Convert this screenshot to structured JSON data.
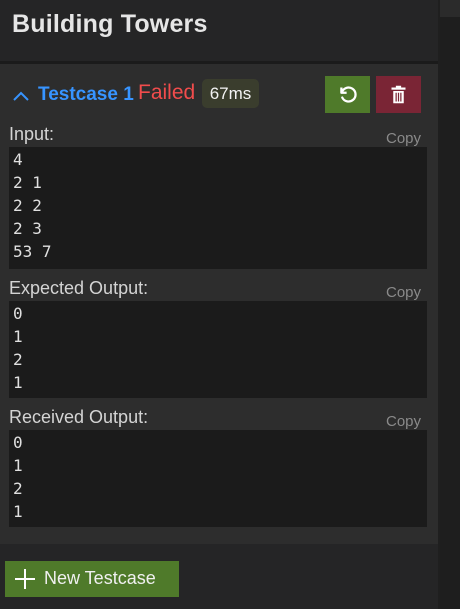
{
  "panel": {
    "title": "Building Towers"
  },
  "testcase": {
    "name": "Testcase 1",
    "status": "Failed",
    "time": "67ms",
    "expanded": true
  },
  "input": {
    "label": "Input:",
    "copy": "Copy",
    "lines": [
      "4",
      "2 1",
      "2 2",
      "2 3",
      "53 7"
    ]
  },
  "expected": {
    "label": "Expected Output:",
    "copy": "Copy",
    "lines": [
      "0",
      "1",
      "2",
      "1"
    ]
  },
  "received": {
    "label": "Received Output:",
    "copy": "Copy",
    "lines": [
      "0",
      "1",
      "2",
      "1"
    ]
  },
  "actions": {
    "new_testcase": "New Testcase"
  },
  "colors": {
    "accent_blue": "#3794ff",
    "fail_red": "#f14c4c",
    "button_green": "#4f7a2a",
    "button_red": "#7a2535"
  },
  "icons": {
    "collapse": "chevron-up-icon",
    "rerun": "rerun-icon",
    "delete": "trash-icon",
    "add": "plus-icon"
  }
}
